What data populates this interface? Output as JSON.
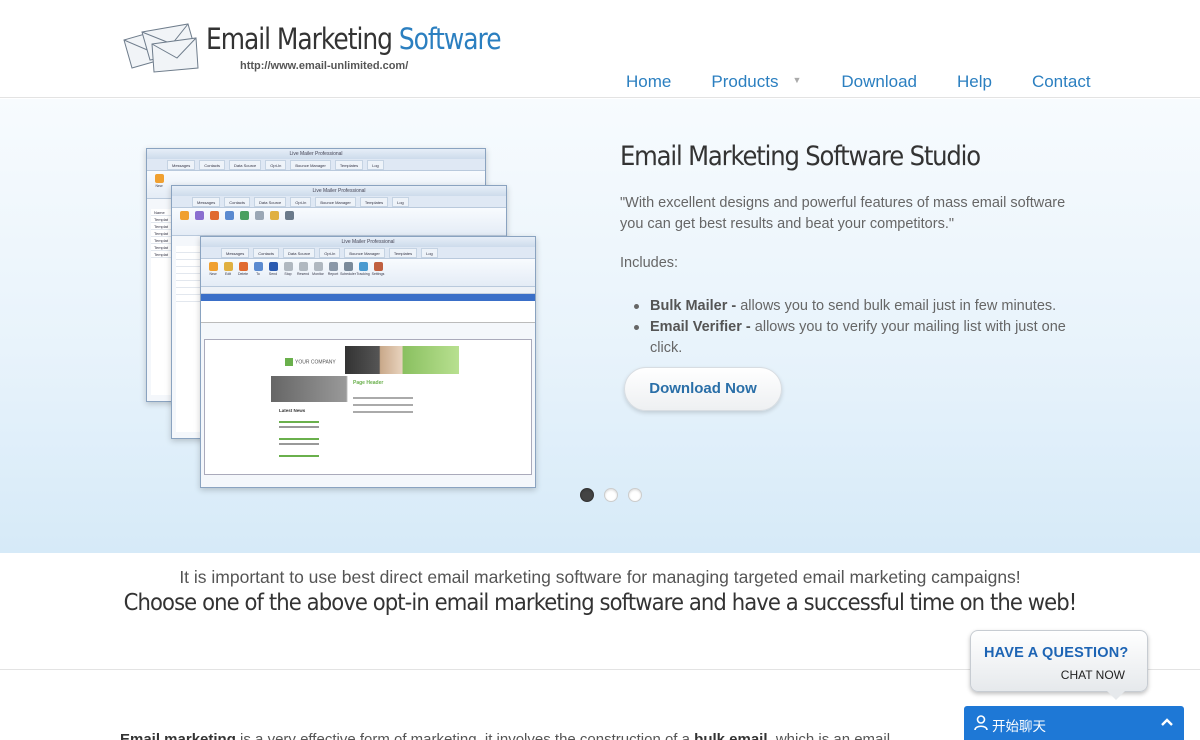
{
  "header": {
    "logo": {
      "title_main": "Email Marketing ",
      "title_accent": "Software",
      "url": "http://www.email-unlimited.com/"
    },
    "nav": [
      {
        "label": "Home"
      },
      {
        "label": "Products",
        "has_dropdown": true
      },
      {
        "label": "Download"
      },
      {
        "label": "Help"
      },
      {
        "label": "Contact"
      }
    ]
  },
  "hero": {
    "title": "Email Marketing Software Studio",
    "quote": "\"With excellent designs and powerful features of mass email software you can get best results and beat your competitors.\"",
    "includes_label": "Includes:",
    "features": [
      {
        "name": "Bulk Mailer -",
        "desc": " allows you to send bulk email just in few minutes."
      },
      {
        "name": "Email Verifier -",
        "desc": " allows you to verify your mailing list with just one click."
      }
    ],
    "cta_label": "Download Now",
    "slides": {
      "count": 3,
      "active_index": 0
    },
    "screenshot": {
      "window_title": "Live Mailer Professional",
      "tabs": [
        "Messages",
        "Contacts",
        "Data Source",
        "Opt-In",
        "Bounce Manager",
        "Templates",
        "Log"
      ],
      "ribbon": [
        "New",
        "Edit",
        "Delete",
        "To",
        "Send",
        "Stop",
        "Resend",
        "Monitor",
        "Report",
        "Scheduler",
        "Tracking",
        "Settings"
      ],
      "sidebar_items": [
        "Name",
        "Templat",
        "Templat",
        "Templat",
        "Templat",
        "Templat",
        "Templat"
      ],
      "preview": {
        "company": "YOUR COMPANY",
        "page_header": "Page Header",
        "latest_news": "Latest News"
      }
    }
  },
  "tagline": {
    "line1": "It is important to use best direct email marketing software for managing targeted email marketing campaigns!",
    "line2": "Choose one of the above opt-in email marketing software and have a successful time on the web!"
  },
  "body": {
    "lead_bold": "Email marketing",
    "lead_text": " is a very effective form of marketing, it involves the construction of a ",
    "lead_bold2": "bulk email",
    "lead_text2": ", which is an email"
  },
  "chat": {
    "question_line1": "HAVE A QUESTION?",
    "question_line2": "CHAT NOW",
    "bar_label": "开始聊天",
    "bar_color": "#1e78d6"
  },
  "colors": {
    "accent": "#2b7fc0",
    "hero_gradient_bottom": "#d6eaf8"
  }
}
